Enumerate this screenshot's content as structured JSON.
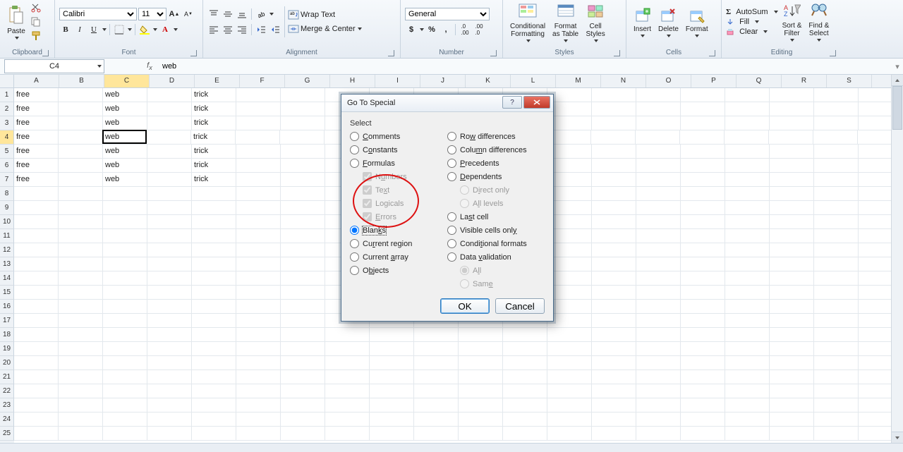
{
  "ribbon": {
    "clipboard": {
      "label": "Clipboard",
      "paste": "Paste"
    },
    "font": {
      "label": "Font",
      "name": "Calibri",
      "size": "11"
    },
    "alignment": {
      "label": "Alignment",
      "wrap": "Wrap Text",
      "merge": "Merge & Center"
    },
    "number": {
      "label": "Number",
      "format": "General"
    },
    "styles": {
      "label": "Styles",
      "cond": "Conditional\nFormatting",
      "table": "Format\nas Table",
      "cell": "Cell\nStyles"
    },
    "cells": {
      "label": "Cells",
      "insert": "Insert",
      "delete": "Delete",
      "format": "Format"
    },
    "editing": {
      "label": "Editing",
      "autosum": "AutoSum",
      "fill": "Fill",
      "clear": "Clear",
      "sort": "Sort &\nFilter",
      "find": "Find &\nSelect"
    }
  },
  "formula_bar": {
    "name_box": "C4",
    "fx_value": "web"
  },
  "columns": [
    "A",
    "B",
    "C",
    "D",
    "E",
    "F",
    "G",
    "H",
    "I",
    "J",
    "K",
    "L",
    "M",
    "N",
    "O",
    "P",
    "Q",
    "R",
    "S"
  ],
  "active": {
    "row": 4,
    "col": "C"
  },
  "rows": [
    {
      "n": 1,
      "A": "free",
      "C": "web",
      "E": "trick"
    },
    {
      "n": 2,
      "A": "free",
      "C": "web",
      "E": "trick"
    },
    {
      "n": 3,
      "A": "free",
      "C": "web",
      "E": "trick"
    },
    {
      "n": 4,
      "A": "free",
      "C": "web",
      "E": "trick"
    },
    {
      "n": 5,
      "A": "free",
      "C": "web",
      "E": "trick"
    },
    {
      "n": 6,
      "A": "free",
      "C": "web",
      "E": "trick"
    },
    {
      "n": 7,
      "A": "free",
      "C": "web",
      "E": "trick"
    },
    {
      "n": 8
    },
    {
      "n": 9
    },
    {
      "n": 10
    },
    {
      "n": 11
    },
    {
      "n": 12
    },
    {
      "n": 13
    },
    {
      "n": 14
    },
    {
      "n": 15
    },
    {
      "n": 16
    },
    {
      "n": 17
    },
    {
      "n": 18
    },
    {
      "n": 19
    },
    {
      "n": 20
    },
    {
      "n": 21
    },
    {
      "n": 22
    },
    {
      "n": 23
    },
    {
      "n": 24
    },
    {
      "n": 25
    }
  ],
  "dialog": {
    "title": "Go To Special",
    "section": "Select",
    "left": [
      {
        "key": "comments",
        "label": "Comments",
        "u": "C",
        "type": "radio"
      },
      {
        "key": "constants",
        "label": "Constants",
        "u": "o",
        "type": "radio"
      },
      {
        "key": "formulas",
        "label": "Formulas",
        "u": "F",
        "type": "radio"
      },
      {
        "key": "numbers",
        "label": "Numbers",
        "u": "u",
        "type": "check",
        "disabled": true,
        "checked": true,
        "sub": true
      },
      {
        "key": "text",
        "label": "Text",
        "u": "x",
        "type": "check",
        "disabled": true,
        "checked": true,
        "sub": true
      },
      {
        "key": "logicals",
        "label": "Logicals",
        "u": "g",
        "type": "check",
        "disabled": true,
        "checked": true,
        "sub": true
      },
      {
        "key": "errors",
        "label": "Errors",
        "u": "E",
        "type": "check",
        "disabled": true,
        "checked": true,
        "sub": true
      },
      {
        "key": "blanks",
        "label": "Blanks",
        "u": "k",
        "type": "radio",
        "checked": true,
        "focus": true
      },
      {
        "key": "current_region",
        "label": "Current region",
        "u": "r",
        "type": "radio"
      },
      {
        "key": "current_array",
        "label": "Current array",
        "u": "a",
        "type": "radio"
      },
      {
        "key": "objects",
        "label": "Objects",
        "u": "b",
        "type": "radio"
      }
    ],
    "right": [
      {
        "key": "row_diff",
        "label": "Row differences",
        "u": "w",
        "type": "radio"
      },
      {
        "key": "col_diff",
        "label": "Column differences",
        "u": "m",
        "type": "radio"
      },
      {
        "key": "precedents",
        "label": "Precedents",
        "u": "P",
        "type": "radio"
      },
      {
        "key": "dependents",
        "label": "Dependents",
        "u": "D",
        "type": "radio"
      },
      {
        "key": "direct",
        "label": "Direct only",
        "u": "I",
        "type": "radio",
        "disabled": true,
        "checked": true,
        "sub": true
      },
      {
        "key": "all_levels",
        "label": "All levels",
        "u": "l",
        "type": "radio",
        "disabled": true,
        "sub": true
      },
      {
        "key": "last_cell",
        "label": "Last cell",
        "u": "s",
        "type": "radio"
      },
      {
        "key": "visible",
        "label": "Visible cells only",
        "u": "y",
        "type": "radio"
      },
      {
        "key": "cond_fmt",
        "label": "Conditional formats",
        "u": "t",
        "type": "radio"
      },
      {
        "key": "data_val",
        "label": "Data validation",
        "u": "v",
        "type": "radio"
      },
      {
        "key": "all",
        "label": "All",
        "u": "l",
        "type": "radio",
        "disabled": true,
        "checked": true,
        "sub": true
      },
      {
        "key": "same",
        "label": "Same",
        "u": "e",
        "type": "radio",
        "disabled": true,
        "sub": true
      }
    ],
    "ok": "OK",
    "cancel": "Cancel"
  }
}
